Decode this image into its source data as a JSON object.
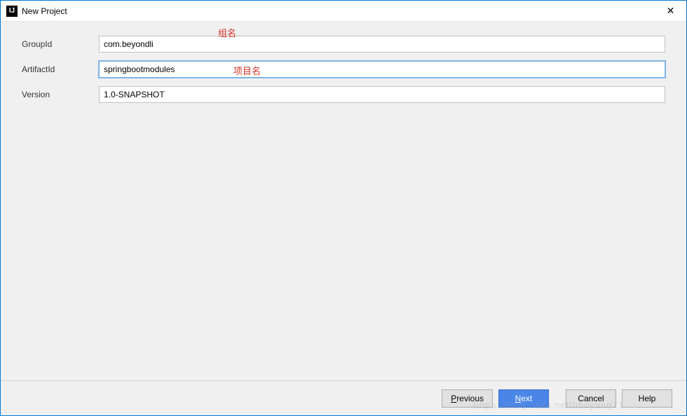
{
  "window": {
    "title": "New Project",
    "icon_text": "IJ"
  },
  "form": {
    "groupid": {
      "label": "GroupId",
      "value": "com.beyondli",
      "annotation": "组名"
    },
    "artifactid": {
      "label": "ArtifactId",
      "value": "springbootmodules",
      "annotation": "项目名"
    },
    "version": {
      "label": "Version",
      "value": "1.0-SNAPSHOT"
    }
  },
  "footer": {
    "previous": "Previous",
    "next": "Next",
    "cancel": "Cancel",
    "help": "Help"
  },
  "watermark": "https://blog.csdn.net/liboyang71"
}
